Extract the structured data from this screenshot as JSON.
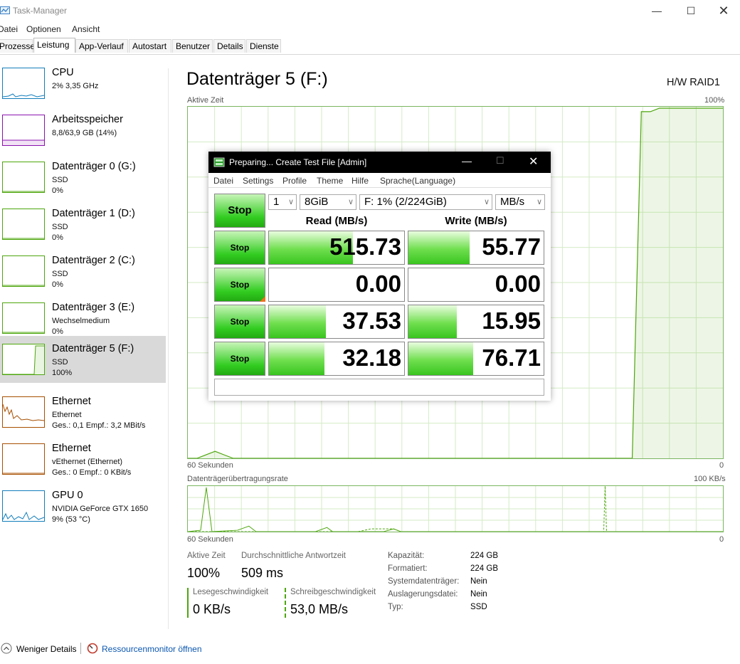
{
  "window": {
    "title": "Task-Manager"
  },
  "menu": [
    "Datei",
    "Optionen",
    "Ansicht"
  ],
  "tabs": [
    "Prozesse",
    "Leistung",
    "App-Verlauf",
    "Autostart",
    "Benutzer",
    "Details",
    "Dienste"
  ],
  "active_tab": "Leistung",
  "sidebar": [
    {
      "name": "CPU",
      "line1": "2% 3,35 GHz",
      "line2": "",
      "color": "#117dbb"
    },
    {
      "name": "Arbeitsspeicher",
      "line1": "8,8/63,9 GB (14%)",
      "line2": "",
      "color": "#8b12ae"
    },
    {
      "name": "Datenträger 0 (G:)",
      "line1": "SSD",
      "line2": "0%",
      "color": "#4da60c"
    },
    {
      "name": "Datenträger 1 (D:)",
      "line1": "SSD",
      "line2": "0%",
      "color": "#4da60c"
    },
    {
      "name": "Datenträger 2 (C:)",
      "line1": "SSD",
      "line2": "0%",
      "color": "#4da60c"
    },
    {
      "name": "Datenträger 3 (E:)",
      "line1": "Wechselmedium",
      "line2": "0%",
      "color": "#4da60c"
    },
    {
      "name": "Datenträger 5 (F:)",
      "line1": "SSD",
      "line2": "100%",
      "color": "#4da60c"
    },
    {
      "name": "Ethernet",
      "line1": "Ethernet",
      "line2": "Ges.: 0,1 Empf.: 3,2 MBit/s",
      "color": "#a74f01"
    },
    {
      "name": "Ethernet",
      "line1": "vEthernet (Ethernet)",
      "line2": "Ges.: 0 Empf.: 0 KBit/s",
      "color": "#a74f01"
    },
    {
      "name": "GPU 0",
      "line1": "NVIDIA GeForce GTX 1650",
      "line2": "9% (53 °C)",
      "color": "#117dbb"
    }
  ],
  "main": {
    "title": "Datenträger 5 (F:)",
    "model": "H/W RAID1",
    "graph1": {
      "label": "Aktive Zeit",
      "max": "100%",
      "time": "60 Sekunden",
      "zero": "0",
      "values": [
        0,
        0,
        1,
        2,
        1,
        0,
        0,
        0,
        0,
        0,
        0,
        0,
        0,
        0,
        0,
        0,
        0,
        0,
        0,
        0,
        0,
        0,
        0,
        0,
        0,
        0,
        0,
        0,
        0,
        0,
        0,
        0,
        0,
        0,
        0,
        0,
        0,
        0,
        0,
        0,
        0,
        0,
        0,
        0,
        0,
        0,
        0,
        0,
        0,
        0,
        99,
        99,
        100,
        100,
        100,
        100,
        100,
        100,
        100,
        100
      ]
    },
    "graph2": {
      "label": "Datenträgerübertragungsrate",
      "max": "100 KB/s",
      "time": "60 Sekunden",
      "zero": "0"
    },
    "stats": {
      "active_label": "Aktive Zeit",
      "active_value": "100%",
      "resp_label": "Durchschnittliche Antwortzeit",
      "resp_value": "509 ms",
      "read_label": "Lesegeschwindigkeit",
      "read_value": "0 KB/s",
      "write_label": "Schreibgeschwindigkeit",
      "write_value": "53,0 MB/s"
    },
    "info": [
      {
        "key": "Kapazität:",
        "value": "224 GB"
      },
      {
        "key": "Formatiert:",
        "value": "224 GB"
      },
      {
        "key": "Systemdatenträger:",
        "value": "Nein"
      },
      {
        "key": "Auslagerungsdatei:",
        "value": "Nein"
      },
      {
        "key": "Typ:",
        "value": "SSD"
      }
    ]
  },
  "footer": {
    "less_details": "Weniger Details",
    "resource_monitor": "Ressourcenmonitor öffnen"
  },
  "cdm": {
    "title": "Preparing... Create Test File [Admin]",
    "menu": [
      "Datei",
      "Settings",
      "Profile",
      "Theme",
      "Hilfe",
      "Sprache(Language)"
    ],
    "main_button": "Stop",
    "count": "1",
    "size": "8GiB",
    "drive": "F: 1% (2/224GiB)",
    "unit": "MB/s",
    "read_header": "Read (MB/s)",
    "write_header": "Write (MB/s)",
    "rows": [
      {
        "button": "Stop",
        "read": "515.73",
        "write": "55.77",
        "read_fill": 0.62,
        "write_fill": 0.45
      },
      {
        "button": "Stop",
        "read": "0.00",
        "write": "0.00",
        "read_fill": 0.0,
        "write_fill": 0.0
      },
      {
        "button": "Stop",
        "read": "37.53",
        "write": "15.95",
        "read_fill": 0.42,
        "write_fill": 0.36
      },
      {
        "button": "Stop",
        "read": "32.18",
        "write": "76.71",
        "read_fill": 0.41,
        "write_fill": 0.48
      }
    ],
    "comment": ""
  }
}
